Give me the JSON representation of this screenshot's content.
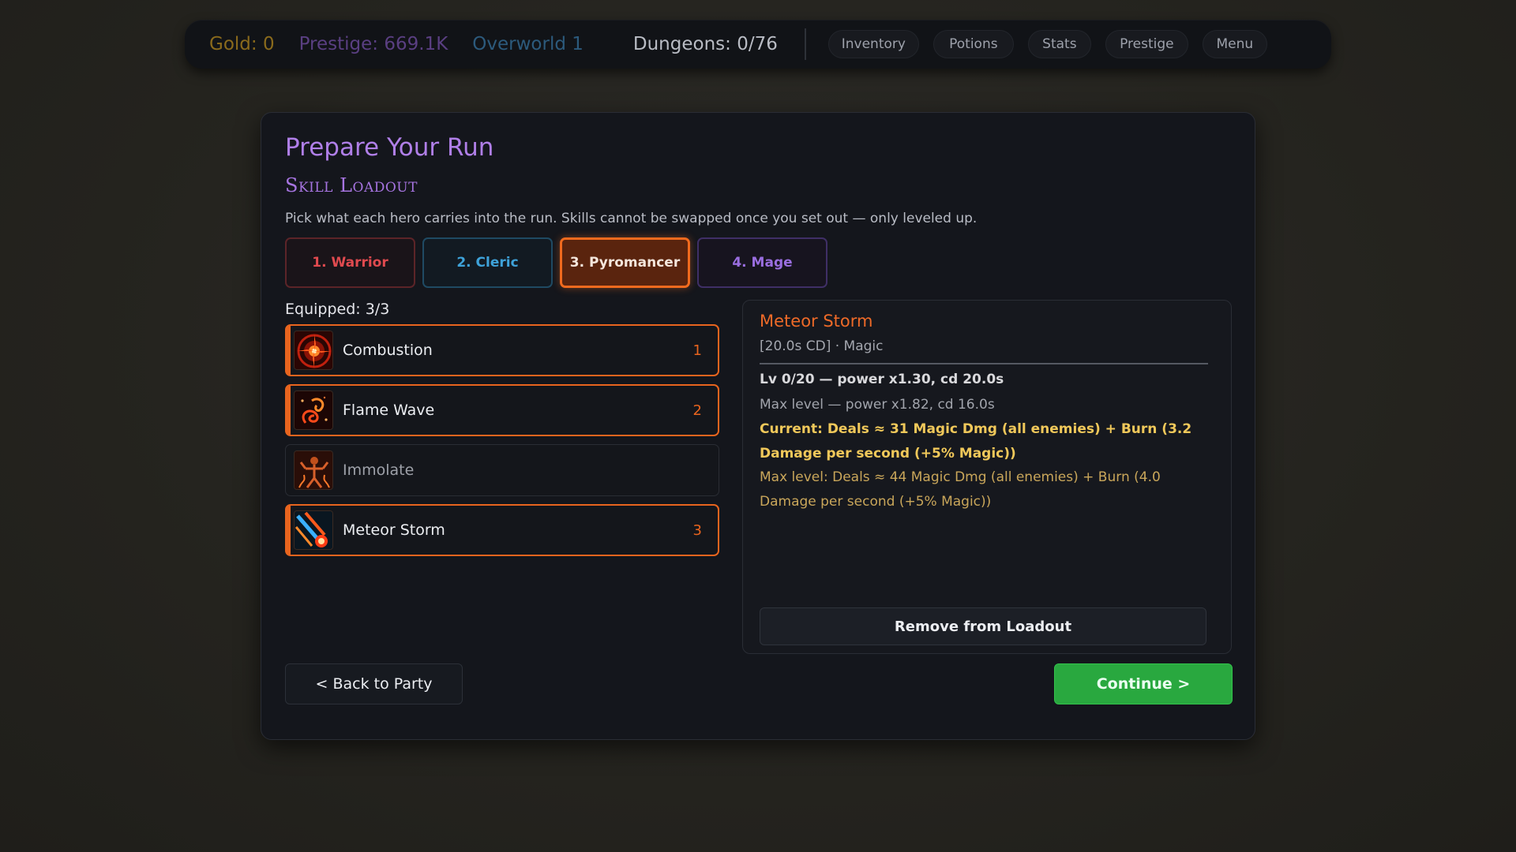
{
  "topbar": {
    "gold": "Gold: 0",
    "prestige": "Prestige: 669.1K",
    "overworld": "Overworld 1",
    "dungeons": "Dungeons: 0/76",
    "nav": [
      "Inventory",
      "Potions",
      "Stats",
      "Prestige",
      "Menu"
    ]
  },
  "panel": {
    "title": "Prepare Your Run",
    "subtitle": "Skill Loadout",
    "description": "Pick what each hero carries into the run. Skills cannot be swapped once you set out — only leveled up."
  },
  "heroes": [
    {
      "label": "1. Warrior",
      "color": "#e04a4f"
    },
    {
      "label": "2. Cleric",
      "color": "#3ea2d9"
    },
    {
      "label": "3. Pyromancer",
      "color": "#f06a1e",
      "active": true
    },
    {
      "label": "4. Mage",
      "color": "#9a6ee0"
    }
  ],
  "loadout": {
    "equipped": "Equipped: 3/3",
    "skills": [
      {
        "name": "Combustion",
        "slot": "1",
        "icon": "combustion-icon",
        "equipped": true
      },
      {
        "name": "Flame Wave",
        "slot": "2",
        "icon": "flame-wave-icon",
        "equipped": true
      },
      {
        "name": "Immolate",
        "slot": "",
        "icon": "immolate-icon",
        "equipped": false
      },
      {
        "name": "Meteor Storm",
        "slot": "3",
        "icon": "meteor-storm-icon",
        "equipped": true
      }
    ]
  },
  "detail": {
    "name": "Meteor Storm",
    "meta": "[20.0s CD] · Magic",
    "current_level": "Lv 0/20 — power x1.30, cd 20.0s",
    "max_level": "Max level — power x1.82, cd 16.0s",
    "current_effect": "Current: Deals ≈ 31 Magic Dmg (all enemies) + Burn (3.2 Damage per second (+5% Magic))",
    "max_effect": "Max level: Deals ≈ 44 Magic Dmg (all enemies) + Burn (4.0 Damage per second (+5% Magic))",
    "remove_label": "Remove from Loadout"
  },
  "actions": {
    "back": "< Back to Party",
    "continue": "Continue >"
  },
  "colors": {
    "accent": "#e8641e",
    "continue": "#29a83f",
    "title": "#b07fe8"
  }
}
